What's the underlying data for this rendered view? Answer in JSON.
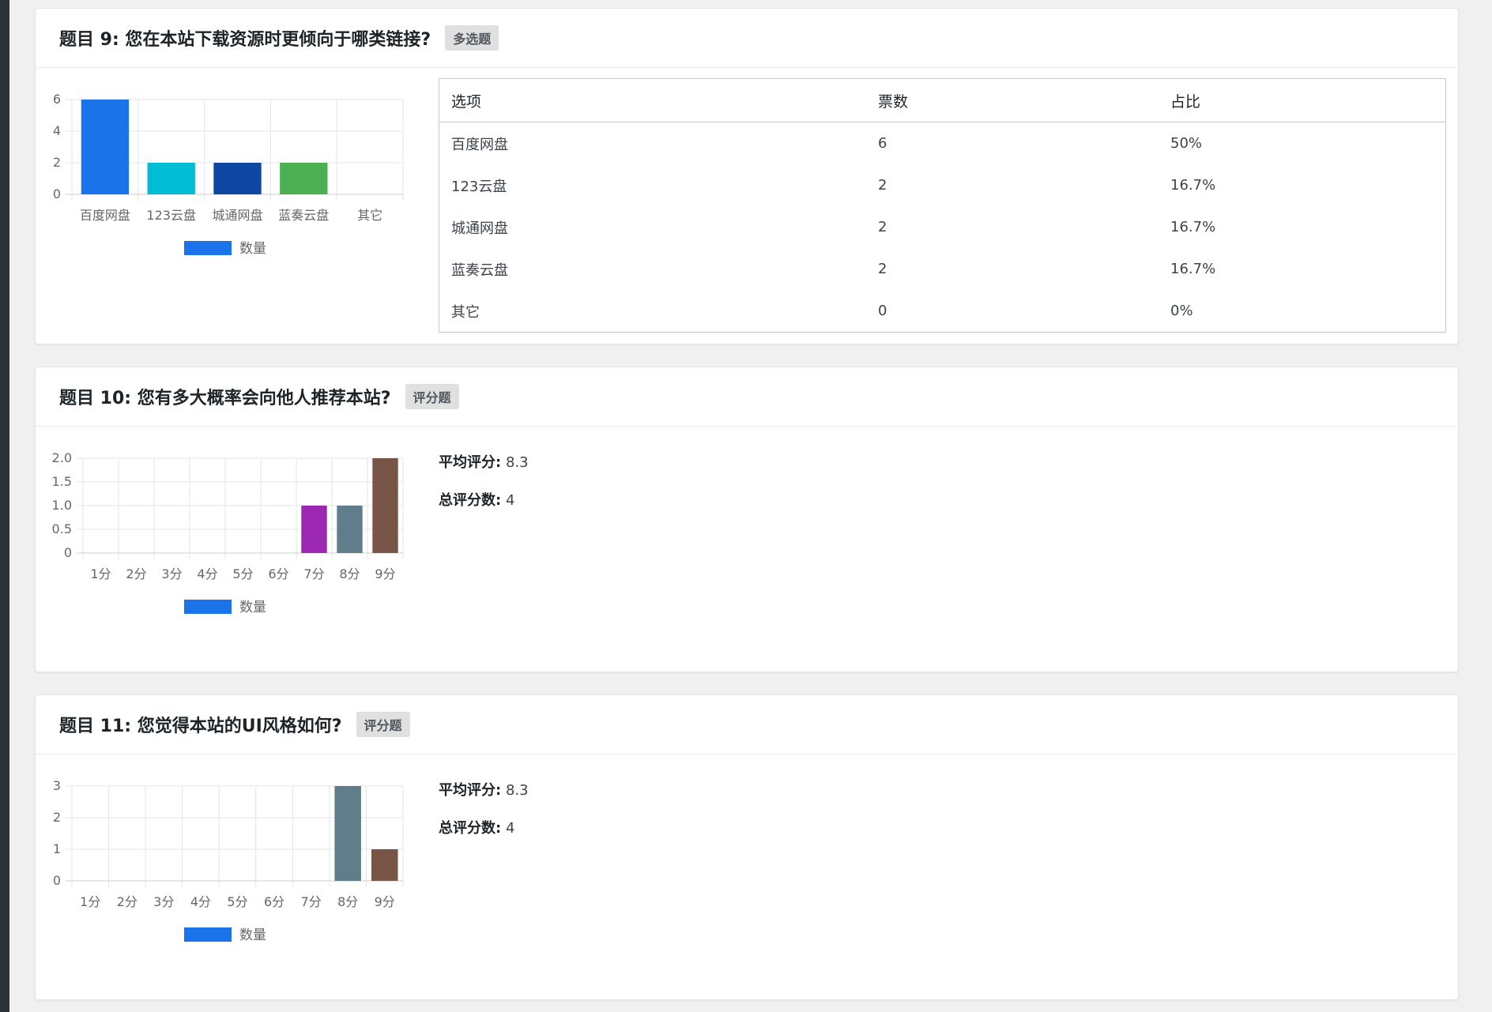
{
  "questions": [
    {
      "title": "题目 9: 您在本站下载资源时更倾向于哪类链接?",
      "badge": "多选题",
      "table": {
        "headers": [
          "选项",
          "票数",
          "占比"
        ],
        "rows": [
          [
            "百度网盘",
            "6",
            "50%"
          ],
          [
            "123云盘",
            "2",
            "16.7%"
          ],
          [
            "城通网盘",
            "2",
            "16.7%"
          ],
          [
            "蓝奏云盘",
            "2",
            "16.7%"
          ],
          [
            "其它",
            "0",
            "0%"
          ]
        ]
      }
    },
    {
      "title": "题目 10: 您有多大概率会向他人推荐本站?",
      "badge": "评分题",
      "stats": {
        "avg_label": "平均评分:",
        "avg_value": "8.3",
        "total_label": "总评分数:",
        "total_value": "4"
      }
    },
    {
      "title": "题目 11: 您觉得本站的UI风格如何?",
      "badge": "评分题",
      "stats": {
        "avg_label": "平均评分:",
        "avg_value": "8.3",
        "total_label": "总评分数:",
        "total_value": "4"
      }
    }
  ],
  "chart_data": [
    {
      "type": "bar",
      "categories": [
        "百度网盘",
        "123云盘",
        "城通网盘",
        "蓝奏云盘",
        "其它"
      ],
      "series": [
        {
          "name": "数量",
          "values": [
            6,
            2,
            2,
            2,
            0
          ]
        }
      ],
      "yticks": [
        "0",
        "2",
        "4",
        "6"
      ],
      "ylim": [
        0,
        6
      ],
      "grid": true,
      "legend": "bottom",
      "bar_colors": [
        "#1a73e8",
        "#00bcd4",
        "#0d47a1",
        "#4caf50",
        "#ff9800"
      ],
      "legend_color": "#1a73e8"
    },
    {
      "type": "bar",
      "categories": [
        "1分",
        "2分",
        "3分",
        "4分",
        "5分",
        "6分",
        "7分",
        "8分",
        "9分"
      ],
      "series": [
        {
          "name": "数量",
          "values": [
            0,
            0,
            0,
            0,
            0,
            0,
            1,
            1,
            2
          ]
        }
      ],
      "yticks": [
        "0",
        "0.5",
        "1.0",
        "1.5",
        "2.0"
      ],
      "ylim": [
        0,
        2
      ],
      "grid": true,
      "legend": "bottom",
      "bar_colors": [
        "#f44336",
        "#e91e63",
        "#ff5722",
        "#ff9800",
        "#ffc107",
        "#8bc34a",
        "#9c27b0",
        "#607d8b",
        "#795548"
      ],
      "legend_color": "#1a73e8"
    },
    {
      "type": "bar",
      "categories": [
        "1分",
        "2分",
        "3分",
        "4分",
        "5分",
        "6分",
        "7分",
        "8分",
        "9分"
      ],
      "series": [
        {
          "name": "数量",
          "values": [
            0,
            0,
            0,
            0,
            0,
            0,
            0,
            3,
            1
          ]
        }
      ],
      "yticks": [
        "0",
        "1",
        "2",
        "3"
      ],
      "ylim": [
        0,
        3
      ],
      "grid": true,
      "legend": "bottom",
      "bar_colors": [
        "#f44336",
        "#e91e63",
        "#ff5722",
        "#ff9800",
        "#ffc107",
        "#8bc34a",
        "#9c27b0",
        "#607d8b",
        "#795548"
      ],
      "legend_color": "#1a73e8"
    }
  ]
}
